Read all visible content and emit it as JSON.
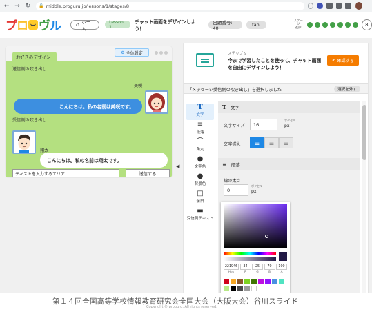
{
  "browser": {
    "url": "middle.proguru.jp/lessons/1/stages/8"
  },
  "header": {
    "home_label": "ホーム",
    "lesson_badge": "Lesson 1",
    "stage_title": "チャット画面をデザインしよう！",
    "problem_number": "出題番号: 40",
    "user": "tani",
    "stage_label_line1": "ステージ",
    "stage_label_line2": "進捗",
    "progress_dots": 7,
    "current_stage": "8"
  },
  "preview": {
    "tab_label": "お好きのデザイン",
    "global_settings_label": "全体設定",
    "sender_section": "送信側の吹き出し",
    "sender_name": "美咲",
    "sender_message": "こんにちは。私の名前は美咲です。",
    "receiver_section": "受信側の吹き出し",
    "receiver_name": "翔太",
    "receiver_message": "こんにちは。私の名前は翔太です。",
    "input_placeholder": "テキストを入力するエリア",
    "send_label": "送信する"
  },
  "task": {
    "step": "ステップ 9",
    "text": "今まで学習したことを使って、チャット画面を自由にデザインしよう！",
    "confirm_label": "確認する"
  },
  "selection": {
    "text": "「メッセージ受信側の吹き出し」を選択しました",
    "deselect_label": "選択を外す"
  },
  "nav": [
    {
      "icon": "T",
      "label": "文字"
    },
    {
      "icon": "≡",
      "label": "段落"
    },
    {
      "icon": "⌒",
      "label": "角丸"
    },
    {
      "icon": "●",
      "label": "文字色"
    },
    {
      "icon": "●",
      "label": "背景色"
    },
    {
      "icon": "□",
      "label": "余白"
    },
    {
      "icon": "▬",
      "label": "受信側テキスト"
    }
  ],
  "props": {
    "text_section": "文字",
    "font_size_label": "文字サイズ",
    "font_size_value": "16",
    "font_size_unit": "px",
    "font_size_note": "ポクセル",
    "align_label": "文字揃え",
    "paragraph_section": "段落",
    "line_width_label": "線の太さ",
    "line_width_value": "0",
    "line_width_unit": "px",
    "line_width_note": "ポクセル"
  },
  "color_picker": {
    "current_color": "#221946",
    "hex": "221946",
    "r": "34",
    "g": "25",
    "b": "70",
    "a": "100",
    "hex_label": "Hex",
    "r_label": "R",
    "g_label": "G",
    "b_label": "B",
    "a_label": "A",
    "swatches": [
      "#d0021b",
      "#f5a623",
      "#8b572a",
      "#7ed321",
      "#417505",
      "#bd10e0",
      "#9013fe",
      "#4a90e2",
      "#50e3c2",
      "#b8e986",
      "#000000",
      "#4a4a4a",
      "#9b9b9b",
      "#ffffff"
    ]
  },
  "footer": {
    "caption": "第１４回全国高等学校情報教育研究会全国大会（大阪大会）谷川スライド",
    "copyright": "Copyright © proguru. All rights reserved."
  },
  "colors": {
    "chat_bg": "#b4e080",
    "send_bubble": "#3d8fe0",
    "accent": "#1e88e5",
    "confirm": "#f57c00",
    "progress": "#43a047"
  }
}
